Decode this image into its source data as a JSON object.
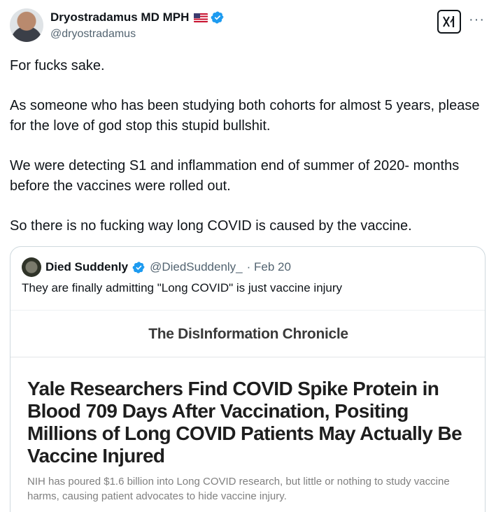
{
  "author": {
    "display_name": "Dryostradamus MD MPH",
    "handle": "@dryostradamus",
    "flag": "us-flag-icon",
    "verified": true
  },
  "icons": {
    "grok": "grok-icon",
    "more": "more-options-icon",
    "verified_color": "#1d9bf0"
  },
  "tweet": {
    "paragraphs": [
      "For fucks sake.",
      "As someone who has been studying both cohorts for almost 5 years, please for the love of god stop this stupid bullshit.",
      "We were detecting S1 and inflammation end of summer of 2020- months before the vaccines were rolled out.",
      "So there is no fucking way long COVID is caused by the vaccine."
    ]
  },
  "quote": {
    "display_name": "Died Suddenly",
    "handle": "@DiedSuddenly_",
    "date": "· Feb 20",
    "text": "They are finally admitting \"Long COVID\" is just vaccine injury",
    "article": {
      "publication": "The DisInformation Chronicle",
      "headline": "Yale Researchers Find COVID Spike Protein in Blood 709 Days After Vaccination, Positing Millions of Long COVID Patients May Actually Be Vaccine Injured",
      "subhead": "NIH has poured $1.6 billion into Long COVID research, but little or nothing to study vaccine harms, causing patient advocates to hide vaccine injury."
    }
  }
}
